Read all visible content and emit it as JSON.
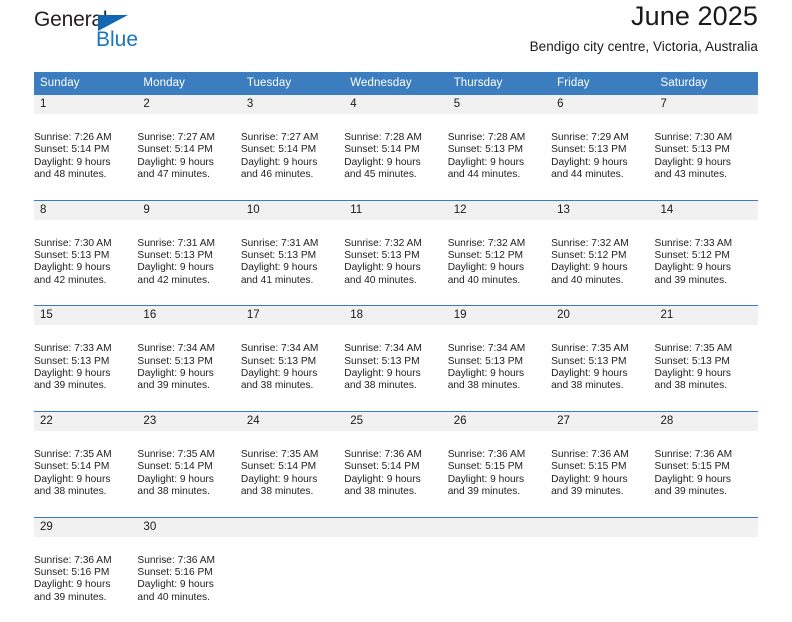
{
  "branding": {
    "logo_primary": "General",
    "logo_secondary": "Blue",
    "logo_triangle_icon": "triangle-icon",
    "logo_primary_color": "#231f20",
    "logo_secondary_color": "#1b75bc"
  },
  "header": {
    "title": "June 2025",
    "subtitle": "Bendigo city centre, Victoria, Australia"
  },
  "theme": {
    "header_bg": "#3b7dbf",
    "header_text": "#ffffff",
    "daynum_bg": "#f1f1f1",
    "row_border": "#3b7dbf",
    "cell_bg": "#ffffff"
  },
  "weekday_headers": [
    "Sunday",
    "Monday",
    "Tuesday",
    "Wednesday",
    "Thursday",
    "Friday",
    "Saturday"
  ],
  "weeks": [
    {
      "days": [
        {
          "day": "1",
          "sunrise": "Sunrise: 7:26 AM",
          "sunset": "Sunset: 5:14 PM",
          "daylight_line1": "Daylight: 9 hours",
          "daylight_line2": "and 48 minutes."
        },
        {
          "day": "2",
          "sunrise": "Sunrise: 7:27 AM",
          "sunset": "Sunset: 5:14 PM",
          "daylight_line1": "Daylight: 9 hours",
          "daylight_line2": "and 47 minutes."
        },
        {
          "day": "3",
          "sunrise": "Sunrise: 7:27 AM",
          "sunset": "Sunset: 5:14 PM",
          "daylight_line1": "Daylight: 9 hours",
          "daylight_line2": "and 46 minutes."
        },
        {
          "day": "4",
          "sunrise": "Sunrise: 7:28 AM",
          "sunset": "Sunset: 5:14 PM",
          "daylight_line1": "Daylight: 9 hours",
          "daylight_line2": "and 45 minutes."
        },
        {
          "day": "5",
          "sunrise": "Sunrise: 7:28 AM",
          "sunset": "Sunset: 5:13 PM",
          "daylight_line1": "Daylight: 9 hours",
          "daylight_line2": "and 44 minutes."
        },
        {
          "day": "6",
          "sunrise": "Sunrise: 7:29 AM",
          "sunset": "Sunset: 5:13 PM",
          "daylight_line1": "Daylight: 9 hours",
          "daylight_line2": "and 44 minutes."
        },
        {
          "day": "7",
          "sunrise": "Sunrise: 7:30 AM",
          "sunset": "Sunset: 5:13 PM",
          "daylight_line1": "Daylight: 9 hours",
          "daylight_line2": "and 43 minutes."
        }
      ]
    },
    {
      "days": [
        {
          "day": "8",
          "sunrise": "Sunrise: 7:30 AM",
          "sunset": "Sunset: 5:13 PM",
          "daylight_line1": "Daylight: 9 hours",
          "daylight_line2": "and 42 minutes."
        },
        {
          "day": "9",
          "sunrise": "Sunrise: 7:31 AM",
          "sunset": "Sunset: 5:13 PM",
          "daylight_line1": "Daylight: 9 hours",
          "daylight_line2": "and 42 minutes."
        },
        {
          "day": "10",
          "sunrise": "Sunrise: 7:31 AM",
          "sunset": "Sunset: 5:13 PM",
          "daylight_line1": "Daylight: 9 hours",
          "daylight_line2": "and 41 minutes."
        },
        {
          "day": "11",
          "sunrise": "Sunrise: 7:32 AM",
          "sunset": "Sunset: 5:13 PM",
          "daylight_line1": "Daylight: 9 hours",
          "daylight_line2": "and 40 minutes."
        },
        {
          "day": "12",
          "sunrise": "Sunrise: 7:32 AM",
          "sunset": "Sunset: 5:12 PM",
          "daylight_line1": "Daylight: 9 hours",
          "daylight_line2": "and 40 minutes."
        },
        {
          "day": "13",
          "sunrise": "Sunrise: 7:32 AM",
          "sunset": "Sunset: 5:12 PM",
          "daylight_line1": "Daylight: 9 hours",
          "daylight_line2": "and 40 minutes."
        },
        {
          "day": "14",
          "sunrise": "Sunrise: 7:33 AM",
          "sunset": "Sunset: 5:12 PM",
          "daylight_line1": "Daylight: 9 hours",
          "daylight_line2": "and 39 minutes."
        }
      ]
    },
    {
      "days": [
        {
          "day": "15",
          "sunrise": "Sunrise: 7:33 AM",
          "sunset": "Sunset: 5:13 PM",
          "daylight_line1": "Daylight: 9 hours",
          "daylight_line2": "and 39 minutes."
        },
        {
          "day": "16",
          "sunrise": "Sunrise: 7:34 AM",
          "sunset": "Sunset: 5:13 PM",
          "daylight_line1": "Daylight: 9 hours",
          "daylight_line2": "and 39 minutes."
        },
        {
          "day": "17",
          "sunrise": "Sunrise: 7:34 AM",
          "sunset": "Sunset: 5:13 PM",
          "daylight_line1": "Daylight: 9 hours",
          "daylight_line2": "and 38 minutes."
        },
        {
          "day": "18",
          "sunrise": "Sunrise: 7:34 AM",
          "sunset": "Sunset: 5:13 PM",
          "daylight_line1": "Daylight: 9 hours",
          "daylight_line2": "and 38 minutes."
        },
        {
          "day": "19",
          "sunrise": "Sunrise: 7:34 AM",
          "sunset": "Sunset: 5:13 PM",
          "daylight_line1": "Daylight: 9 hours",
          "daylight_line2": "and 38 minutes."
        },
        {
          "day": "20",
          "sunrise": "Sunrise: 7:35 AM",
          "sunset": "Sunset: 5:13 PM",
          "daylight_line1": "Daylight: 9 hours",
          "daylight_line2": "and 38 minutes."
        },
        {
          "day": "21",
          "sunrise": "Sunrise: 7:35 AM",
          "sunset": "Sunset: 5:13 PM",
          "daylight_line1": "Daylight: 9 hours",
          "daylight_line2": "and 38 minutes."
        }
      ]
    },
    {
      "days": [
        {
          "day": "22",
          "sunrise": "Sunrise: 7:35 AM",
          "sunset": "Sunset: 5:14 PM",
          "daylight_line1": "Daylight: 9 hours",
          "daylight_line2": "and 38 minutes."
        },
        {
          "day": "23",
          "sunrise": "Sunrise: 7:35 AM",
          "sunset": "Sunset: 5:14 PM",
          "daylight_line1": "Daylight: 9 hours",
          "daylight_line2": "and 38 minutes."
        },
        {
          "day": "24",
          "sunrise": "Sunrise: 7:35 AM",
          "sunset": "Sunset: 5:14 PM",
          "daylight_line1": "Daylight: 9 hours",
          "daylight_line2": "and 38 minutes."
        },
        {
          "day": "25",
          "sunrise": "Sunrise: 7:36 AM",
          "sunset": "Sunset: 5:14 PM",
          "daylight_line1": "Daylight: 9 hours",
          "daylight_line2": "and 38 minutes."
        },
        {
          "day": "26",
          "sunrise": "Sunrise: 7:36 AM",
          "sunset": "Sunset: 5:15 PM",
          "daylight_line1": "Daylight: 9 hours",
          "daylight_line2": "and 39 minutes."
        },
        {
          "day": "27",
          "sunrise": "Sunrise: 7:36 AM",
          "sunset": "Sunset: 5:15 PM",
          "daylight_line1": "Daylight: 9 hours",
          "daylight_line2": "and 39 minutes."
        },
        {
          "day": "28",
          "sunrise": "Sunrise: 7:36 AM",
          "sunset": "Sunset: 5:15 PM",
          "daylight_line1": "Daylight: 9 hours",
          "daylight_line2": "and 39 minutes."
        }
      ]
    },
    {
      "days": [
        {
          "day": "29",
          "sunrise": "Sunrise: 7:36 AM",
          "sunset": "Sunset: 5:16 PM",
          "daylight_line1": "Daylight: 9 hours",
          "daylight_line2": "and 39 minutes."
        },
        {
          "day": "30",
          "sunrise": "Sunrise: 7:36 AM",
          "sunset": "Sunset: 5:16 PM",
          "daylight_line1": "Daylight: 9 hours",
          "daylight_line2": "and 40 minutes."
        },
        {
          "day": "",
          "sunrise": "",
          "sunset": "",
          "daylight_line1": "",
          "daylight_line2": ""
        },
        {
          "day": "",
          "sunrise": "",
          "sunset": "",
          "daylight_line1": "",
          "daylight_line2": ""
        },
        {
          "day": "",
          "sunrise": "",
          "sunset": "",
          "daylight_line1": "",
          "daylight_line2": ""
        },
        {
          "day": "",
          "sunrise": "",
          "sunset": "",
          "daylight_line1": "",
          "daylight_line2": ""
        },
        {
          "day": "",
          "sunrise": "",
          "sunset": "",
          "daylight_line1": "",
          "daylight_line2": ""
        }
      ]
    }
  ]
}
